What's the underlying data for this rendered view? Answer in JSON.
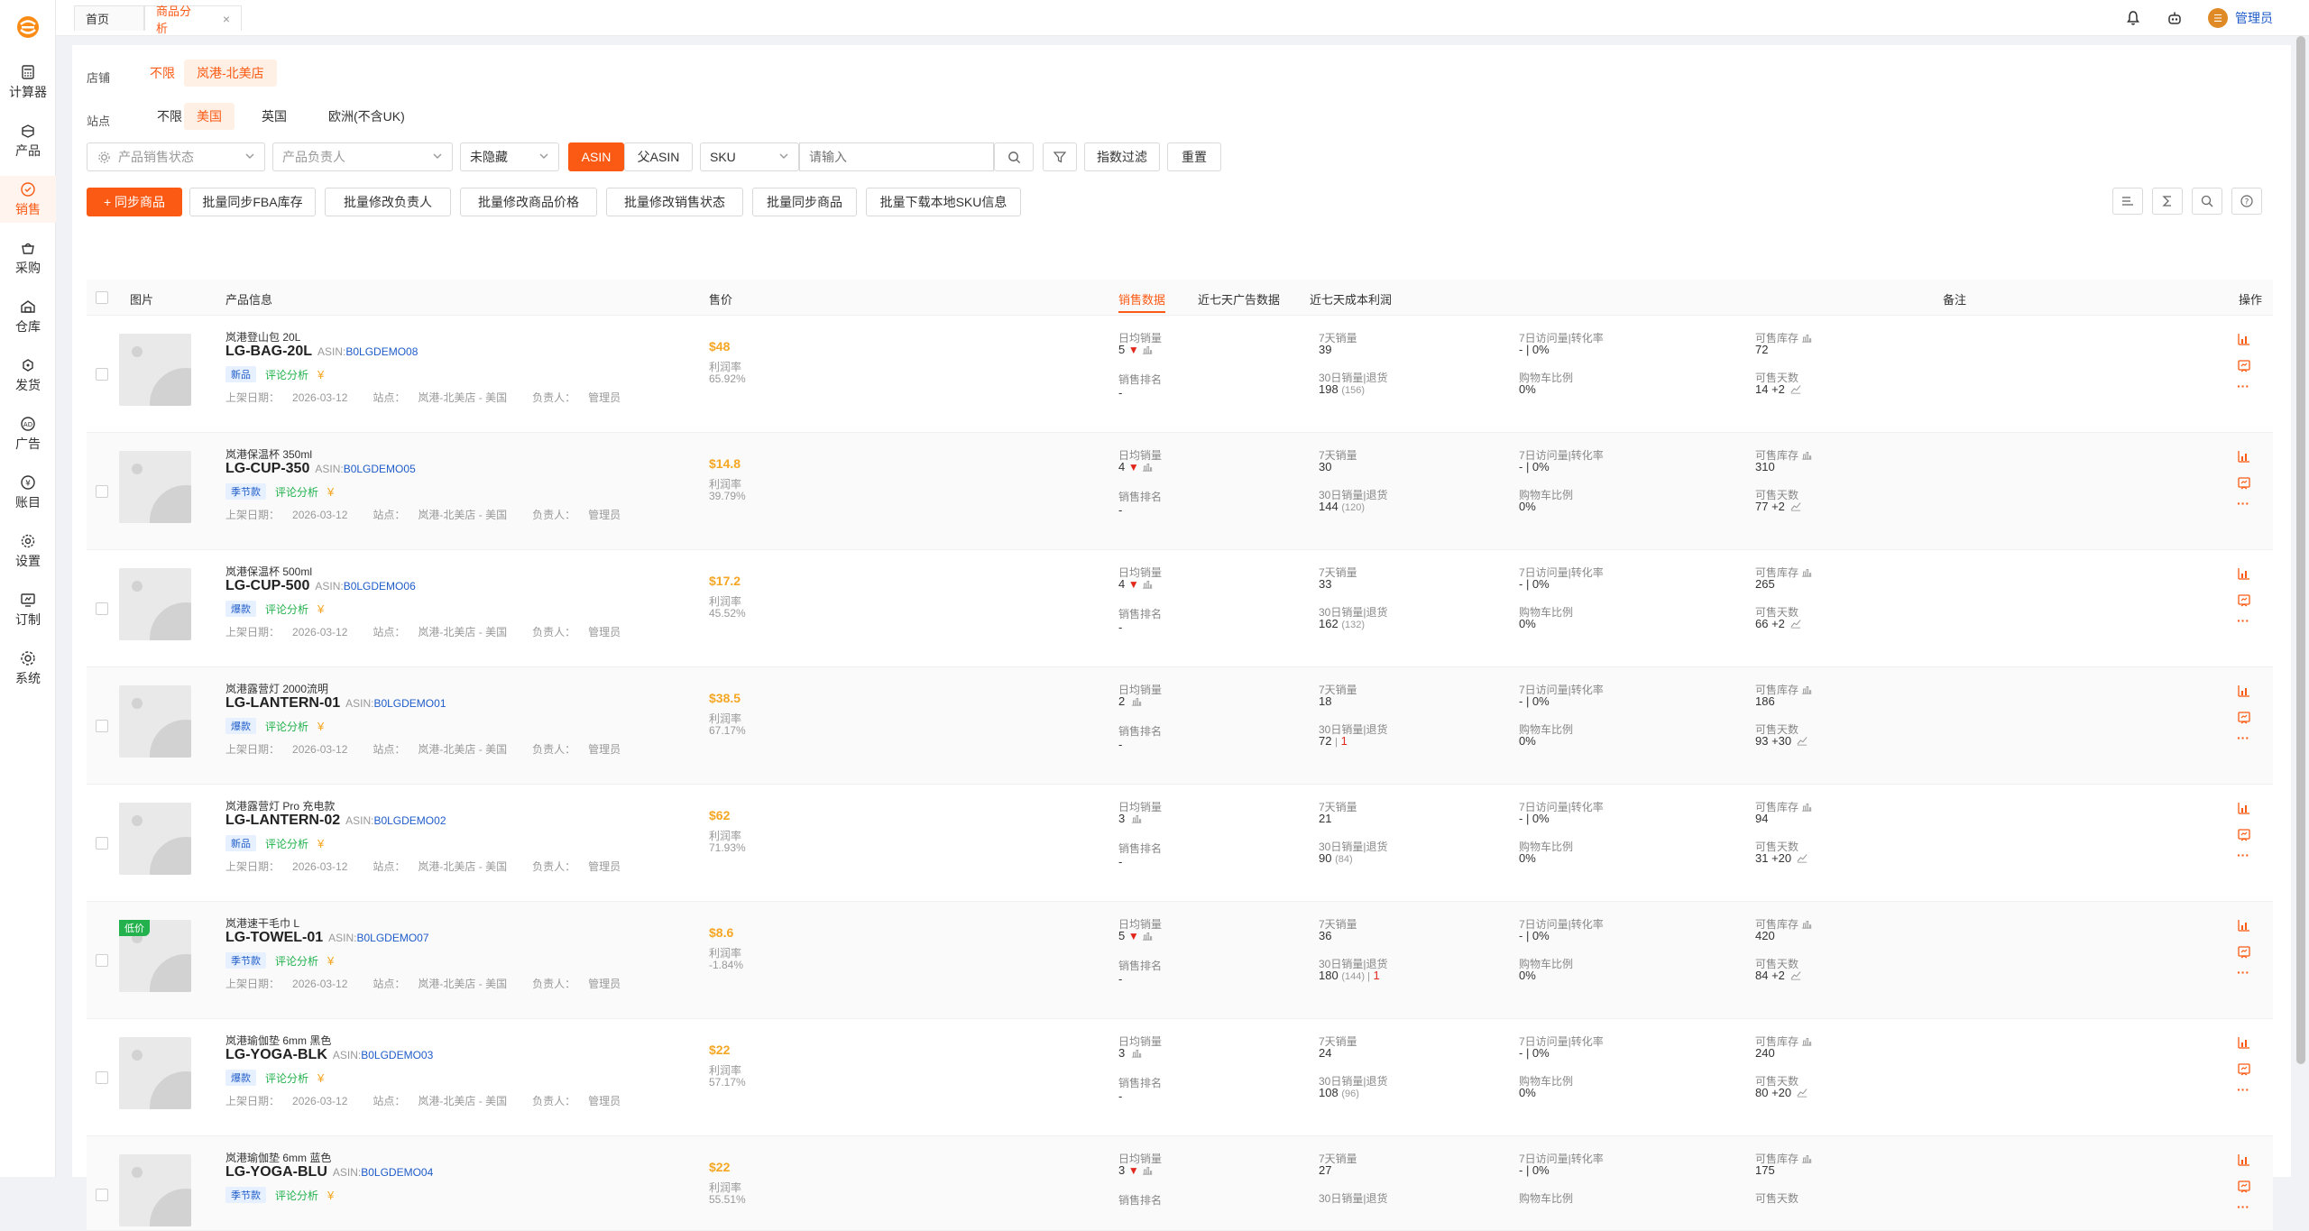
{
  "sidebar": {
    "items": [
      {
        "label": "计算器",
        "icon": "calculator-icon"
      },
      {
        "label": "产品",
        "icon": "box-icon"
      },
      {
        "label": "销售",
        "icon": "sales-icon",
        "active": true
      },
      {
        "label": "采购",
        "icon": "basket-icon"
      },
      {
        "label": "仓库",
        "icon": "warehouse-icon"
      },
      {
        "label": "发货",
        "icon": "truck-icon"
      },
      {
        "label": "广告",
        "icon": "ad-icon"
      },
      {
        "label": "账目",
        "icon": "ledger-icon"
      },
      {
        "label": "设置",
        "icon": "gear-icon"
      },
      {
        "label": "订制",
        "icon": "custom-icon"
      },
      {
        "label": "系统",
        "icon": "system-icon"
      }
    ]
  },
  "topbar": {
    "tabs": [
      {
        "label": "首页"
      },
      {
        "label": "商品分析",
        "closable": true
      }
    ],
    "close_glyph": "×",
    "admin_label": "管理员"
  },
  "filters": {
    "store_label": "店铺",
    "store_options": [
      "不限",
      "岚港-北美店"
    ],
    "site_label": "站点",
    "site_options": [
      "不限",
      "美国",
      "英国",
      "欧洲(不含UK)"
    ],
    "product_status_placeholder": "产品销售状态",
    "owner_placeholder": "产品负责人",
    "hidden_select": "未隐藏",
    "asin_btn": "ASIN",
    "parent_asin_btn": "父ASIN",
    "sku_select": "SKU",
    "search_placeholder": "请输入",
    "metric_filter": "指数过滤",
    "reset": "重置"
  },
  "actions": {
    "sync": "+ 同步商品",
    "buttons": [
      "批量同步FBA库存",
      "批量修改负责人",
      "批量修改商品价格",
      "批量修改销售状态",
      "批量同步商品",
      "批量下载本地SKU信息"
    ]
  },
  "table": {
    "headers": {
      "image": "图片",
      "info": "产品信息",
      "price": "售价",
      "sales": "销售数据",
      "ad7": "近七天广告数据",
      "cost7": "近七天成本利润",
      "note": "备注",
      "ops": "操作"
    },
    "labels": {
      "daily": "日均销量",
      "rank": "销售排名",
      "sales7": "7天销量",
      "sales30": "30日销量|退货",
      "conv7": "7日访问量|转化率",
      "cart": "购物车比例",
      "stock": "可售库存",
      "days": "可售天数",
      "margin": "利润率",
      "listed": "上架日期：",
      "site": "站点：",
      "owner": "负责人：",
      "asin": "ASIN:",
      "review": "评论分析",
      "coin": "¥",
      "more": "···",
      "down_arrow": "▼"
    },
    "rows": [
      {
        "name": "岚港登山包 20L",
        "sku": "LG-BAG-20L",
        "asin": "B0LGDEMO08",
        "tag": "新品",
        "tag_type": "new",
        "date": "2026-03-12",
        "site": "岚港-北美店 - 美国",
        "owner": "管理员",
        "price": "$48",
        "margin": "65.92%",
        "daily": "5",
        "down": true,
        "rank": "-",
        "sales7": "39",
        "sales30": "198",
        "sales30_sub": "(156)",
        "ret": "",
        "conv": "- | 0%",
        "cart": "0%",
        "stock": "72",
        "days": "14 +2"
      },
      {
        "name": "岚港保温杯 350ml",
        "sku": "LG-CUP-350",
        "asin": "B0LGDEMO05",
        "tag": "季节款",
        "tag_type": "season",
        "date": "2026-03-12",
        "site": "岚港-北美店 - 美国",
        "owner": "管理员",
        "price": "$14.8",
        "margin": "39.79%",
        "daily": "4",
        "down": true,
        "rank": "-",
        "sales7": "30",
        "sales30": "144",
        "sales30_sub": "(120)",
        "ret": "",
        "conv": "- | 0%",
        "cart": "0%",
        "stock": "310",
        "days": "77 +2"
      },
      {
        "name": "岚港保温杯 500ml",
        "sku": "LG-CUP-500",
        "asin": "B0LGDEMO06",
        "tag": "爆款",
        "tag_type": "hot",
        "date": "2026-03-12",
        "site": "岚港-北美店 - 美国",
        "owner": "管理员",
        "price": "$17.2",
        "margin": "45.52%",
        "daily": "4",
        "down": true,
        "rank": "-",
        "sales7": "33",
        "sales30": "162",
        "sales30_sub": "(132)",
        "ret": "",
        "conv": "- | 0%",
        "cart": "0%",
        "stock": "265",
        "days": "66 +2"
      },
      {
        "name": "岚港露营灯 2000流明",
        "sku": "LG-LANTERN-01",
        "asin": "B0LGDEMO01",
        "tag": "爆款",
        "tag_type": "hot",
        "date": "2026-03-12",
        "site": "岚港-北美店 - 美国",
        "owner": "管理员",
        "price": "$38.5",
        "margin": "67.17%",
        "daily": "2",
        "down": false,
        "rank": "-",
        "sales7": "18",
        "sales30": "72",
        "sales30_sub": "|",
        "ret": "1",
        "conv": "- | 0%",
        "cart": "0%",
        "stock": "186",
        "days": "93 +30"
      },
      {
        "name": "岚港露营灯 Pro 充电款",
        "sku": "LG-LANTERN-02",
        "asin": "B0LGDEMO02",
        "tag": "新品",
        "tag_type": "new",
        "date": "2026-03-12",
        "site": "岚港-北美店 - 美国",
        "owner": "管理员",
        "price": "$62",
        "margin": "71.93%",
        "daily": "3",
        "down": false,
        "rank": "-",
        "sales7": "21",
        "sales30": "90",
        "sales30_sub": "(84)",
        "ret": "",
        "conv": "- | 0%",
        "cart": "0%",
        "stock": "94",
        "days": "31 +20"
      },
      {
        "name": "岚港速干毛巾 L",
        "sku": "LG-TOWEL-01",
        "asin": "B0LGDEMO07",
        "tag": "季节款",
        "tag_type": "season",
        "low": "低价",
        "date": "2026-03-12",
        "site": "岚港-北美店 - 美国",
        "owner": "管理员",
        "price": "$8.6",
        "margin": "-1.84%",
        "daily": "5",
        "down": true,
        "rank": "-",
        "sales7": "36",
        "sales30": "180",
        "sales30_sub": "(144) |",
        "ret": "1",
        "conv": "- | 0%",
        "cart": "0%",
        "stock": "420",
        "days": "84 +2"
      },
      {
        "name": "岚港瑜伽垫 6mm 黑色",
        "sku": "LG-YOGA-BLK",
        "asin": "B0LGDEMO03",
        "tag": "爆款",
        "tag_type": "hot",
        "date": "2026-03-12",
        "site": "岚港-北美店 - 美国",
        "owner": "管理员",
        "price": "$22",
        "margin": "57.17%",
        "daily": "3",
        "down": false,
        "rank": "-",
        "sales7": "24",
        "sales30": "108",
        "sales30_sub": "(96)",
        "ret": "",
        "conv": "- | 0%",
        "cart": "0%",
        "stock": "240",
        "days": "80 +20"
      },
      {
        "name": "岚港瑜伽垫 6mm 蓝色",
        "sku": "LG-YOGA-BLU",
        "asin": "B0LGDEMO04",
        "tag": "季节款",
        "tag_type": "season",
        "date": "",
        "site": "",
        "owner": "",
        "price": "$22",
        "margin": "55.51%",
        "daily": "3",
        "down": true,
        "rank": "",
        "sales7": "27",
        "sales30": "",
        "sales30_sub": "",
        "ret": "",
        "conv": "- | 0%",
        "cart": "",
        "stock": "175",
        "days": ""
      }
    ]
  },
  "colors": {
    "accent": "#fa5a14",
    "link": "#1f5cc9",
    "price": "#f5a623",
    "green": "#22b14c",
    "red": "#e0281d"
  }
}
